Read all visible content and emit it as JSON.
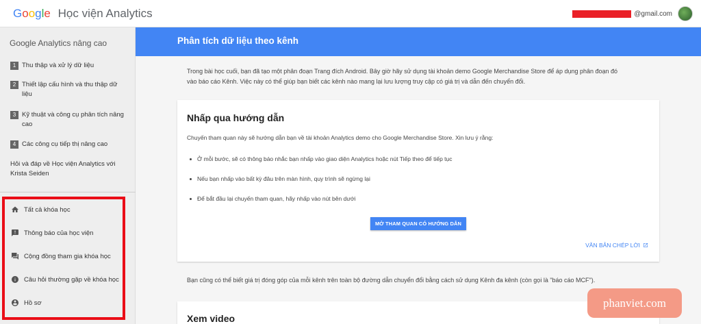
{
  "header": {
    "logo_letters": [
      "G",
      "o",
      "o",
      "g",
      "l",
      "e"
    ],
    "product_name": "Học viện Analytics",
    "email_suffix": "@gmail.com"
  },
  "sidebar": {
    "course_title": "Google Analytics nâng cao",
    "modules": [
      {
        "num": "1",
        "label": "Thu thập và xử lý dữ liệu"
      },
      {
        "num": "2",
        "label": "Thiết lập cấu hình và thu thập dữ liệu"
      },
      {
        "num": "3",
        "label": "Kỹ thuật và công cụ phân tích nâng cao"
      },
      {
        "num": "4",
        "label": "Các công cụ tiếp thị nâng cao"
      }
    ],
    "qa_label": "Hỏi và đáp về Học viện Analytics với Krista Seiden",
    "nav": [
      {
        "icon": "home-icon",
        "label": "Tất cả khóa học"
      },
      {
        "icon": "announcement-icon",
        "label": "Thông báo của học viện"
      },
      {
        "icon": "forum-icon",
        "label": "Cộng đồng tham gia khóa học"
      },
      {
        "icon": "info-icon",
        "label": "Câu hỏi thường gặp về khóa học"
      },
      {
        "icon": "account-icon",
        "label": "Hồ sơ"
      }
    ]
  },
  "main": {
    "banner_title": "Phân tích dữ liệu theo kênh",
    "intro_line1": "Trong bài học cuối, bạn đã tạo một phân đoạn Trang đích Android. Bây giờ hãy sử dụng tài khoản demo Google Merchandise Store để áp dụng phân đoạn đó",
    "intro_line2": "vào báo cáo Kênh. Việc này có thể giúp bạn biết các kênh nào mang lại lưu lượng truy cập có giá trị và dẫn đến chuyển đổi.",
    "card": {
      "title": "Nhấp qua hướng dẫn",
      "description": "Chuyến tham quan này sẽ hướng dẫn bạn về tài khoản Analytics demo cho Google Merchandise Store. Xin lưu ý rằng:",
      "bullets": [
        "Ở mỗi bước, sẽ có thông báo nhắc bạn nhấp vào giao diện Analytics hoặc nút Tiếp theo để tiếp tục",
        "Nếu bạn nhấp vào bất kỳ đâu trên màn hình, quy trình sẽ ngừng lại",
        "Để bắt đầu lại chuyến tham quan, hãy nhấp vào nút bên dưới"
      ],
      "button_label": "MỞ THAM QUAN CÓ HƯỚNG DẪN",
      "transcript_label": "VĂN BẢN CHÉP LỜI"
    },
    "footer_text": "Bạn cũng có thể biết giá trị đóng góp của mỗi kênh trên toàn bộ đường dẫn chuyển đổi bằng cách sử dụng Kênh đa kênh (còn gọi là \"báo cáo MCF\").",
    "video_title": "Xem video"
  },
  "watermark": "phanviet.com",
  "colors": {
    "banner": "#4285f4",
    "highlight_border": "#ea0d17",
    "watermark_bg": "#f49a86"
  }
}
